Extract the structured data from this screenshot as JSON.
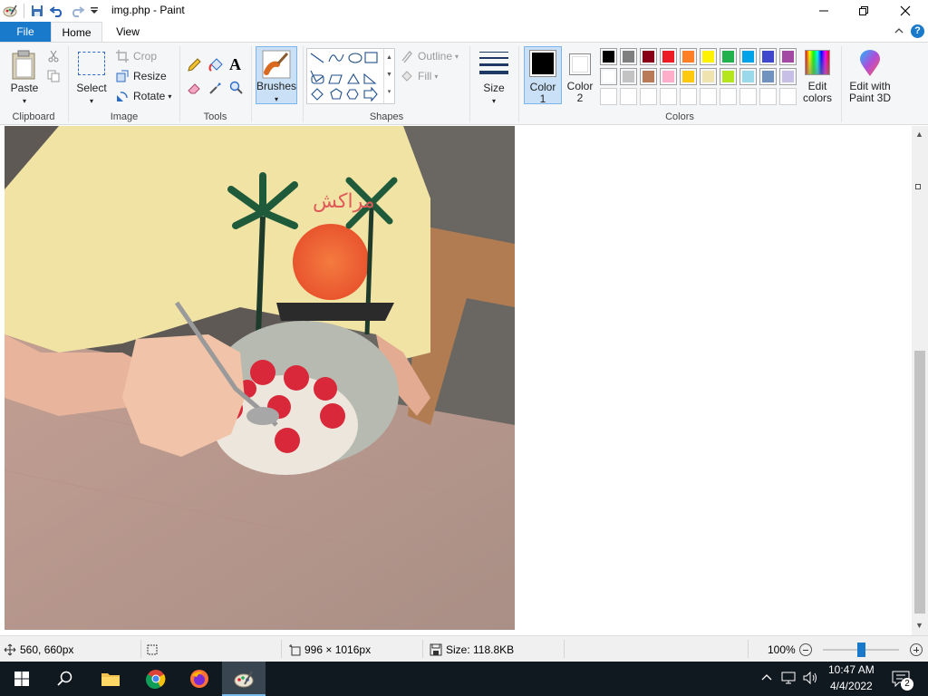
{
  "window": {
    "title": "img.php - Paint"
  },
  "tabs": [
    {
      "label": "File"
    },
    {
      "label": "Home"
    },
    {
      "label": "View"
    }
  ],
  "ribbon": {
    "clipboard": {
      "paste": "Paste",
      "group": "Clipboard"
    },
    "image": {
      "select": "Select",
      "crop": "Crop",
      "resize": "Resize",
      "rotate": "Rotate",
      "group": "Image"
    },
    "tools": {
      "group": "Tools"
    },
    "brushes": {
      "label": "Brushes"
    },
    "shapes": {
      "outline": "Outline",
      "fill": "Fill",
      "group": "Shapes"
    },
    "size": {
      "label": "Size"
    },
    "color1": {
      "label": "Color",
      "num": "1",
      "color": "#000000"
    },
    "color2": {
      "label": "Color",
      "num": "2",
      "color": "#ffffff"
    },
    "colors": {
      "group": "Colors",
      "row1": [
        "#000000",
        "#7f7f7f",
        "#880015",
        "#ed1c24",
        "#ff7f27",
        "#fff200",
        "#22b14c",
        "#00a2e8",
        "#3f48cc",
        "#a349a4"
      ],
      "row2": [
        "#ffffff",
        "#c3c3c3",
        "#b97a57",
        "#ffaec9",
        "#ffc90e",
        "#efe4b0",
        "#b5e61d",
        "#99d9ea",
        "#7092be",
        "#c8bfe7"
      ],
      "row3": [
        "#ffffff",
        "#ffffff",
        "#ffffff",
        "#ffffff",
        "#ffffff",
        "#ffffff",
        "#ffffff",
        "#ffffff",
        "#ffffff",
        "#ffffff"
      ]
    },
    "edit_colors": {
      "line1": "Edit",
      "line2": "colors"
    },
    "paint3d": {
      "line1": "Edit with",
      "line2": "Paint 3D"
    }
  },
  "statusbar": {
    "cursor_pos": "560, 660px",
    "image_size": "996 × 1016px",
    "file_size": "Size: 118.8KB",
    "zoom": "100%"
  },
  "taskbar": {
    "time": "10:47 AM",
    "date": "4/4/2022",
    "notifications": "2"
  }
}
